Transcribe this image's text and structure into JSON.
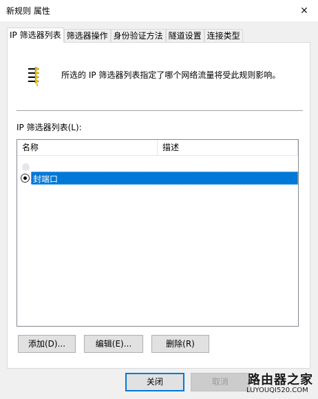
{
  "window": {
    "title": "新规则 属性",
    "close_glyph": "✕"
  },
  "tabs": [
    {
      "label": "IP 筛选器列表",
      "active": true
    },
    {
      "label": "筛选器操作",
      "active": false
    },
    {
      "label": "身份验证方法",
      "active": false
    },
    {
      "label": "隧道设置",
      "active": false
    },
    {
      "label": "连接类型",
      "active": false
    }
  ],
  "info": {
    "icon": "filter-list-icon",
    "text": "所选的 IP 筛选器列表指定了哪个网络流量将受此规则影响。"
  },
  "list": {
    "label": "IP 筛选器列表(L):",
    "columns": [
      "名称",
      "描述"
    ],
    "rows": [
      {
        "name": "封端口",
        "description": "",
        "selected": true
      }
    ]
  },
  "buttons": {
    "add": "添加(D)...",
    "edit": "编辑(E)...",
    "delete": "删除(R)",
    "ok": "关闭",
    "cancel": "取消"
  },
  "watermark": {
    "main": "路由器之家",
    "sub": "LUYOUQI520.COM"
  },
  "colors": {
    "selection": "#0078d7",
    "default_button_border": "#0078d7"
  }
}
